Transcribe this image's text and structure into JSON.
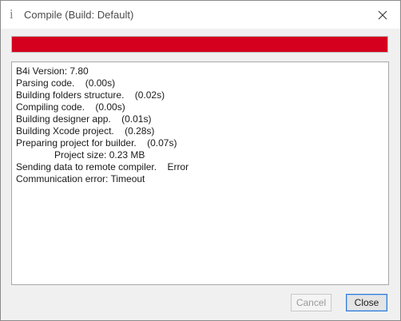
{
  "window": {
    "title": "Compile (Build: Default)",
    "app_icon_glyph": "i"
  },
  "progress": {
    "fraction": 1.0,
    "color": "#d4001d"
  },
  "log": {
    "lines": [
      "B4i Version: 7.80",
      "Parsing code.    (0.00s)",
      "Building folders structure.    (0.02s)",
      "Compiling code.    (0.00s)",
      "Building designer app.    (0.01s)",
      "Building Xcode project.    (0.28s)",
      "Preparing project for builder.    (0.07s)",
      "Project size: 0.23 MB",
      "Sending data to remote compiler.    Error",
      "Communication error: Timeout"
    ]
  },
  "buttons": {
    "cancel_label": "Cancel",
    "close_label": "Close"
  },
  "icons": {
    "app": "info-icon",
    "close": "close-icon"
  }
}
